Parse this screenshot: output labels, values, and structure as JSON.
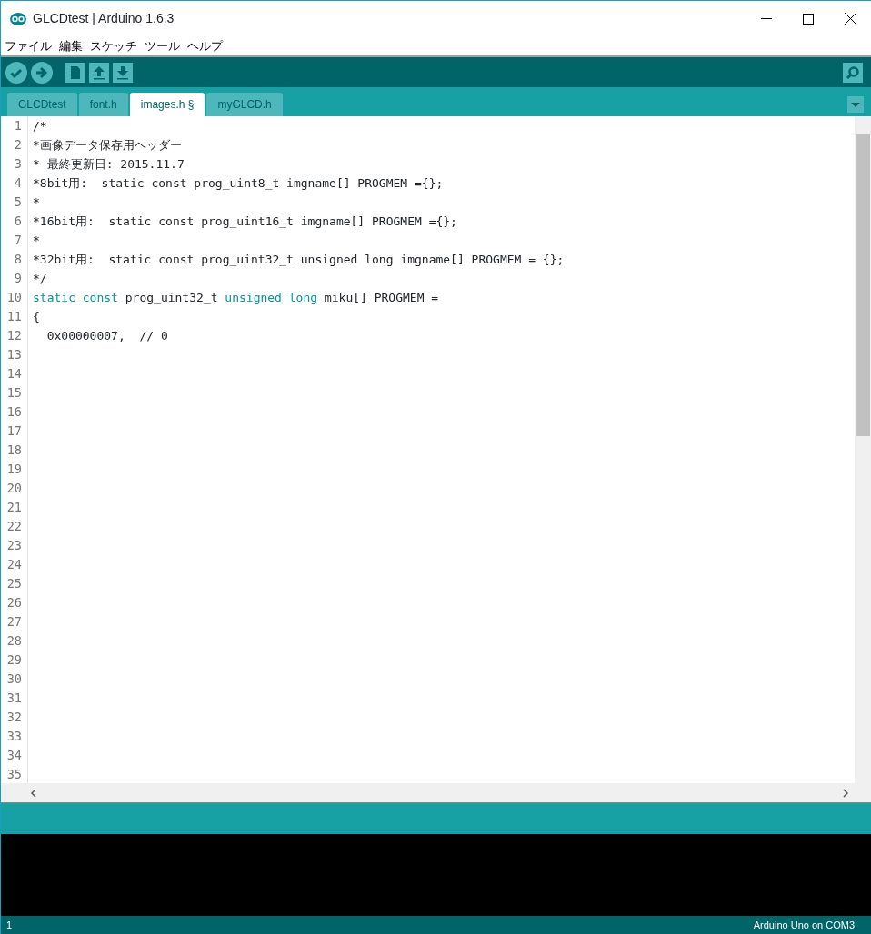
{
  "window": {
    "title": "GLCDtest | Arduino 1.6.3"
  },
  "menu": [
    "ファイル",
    "編集",
    "スケッチ",
    "ツール",
    "ヘルプ"
  ],
  "tabs": [
    {
      "label": "GLCDtest",
      "selected": false
    },
    {
      "label": "font.h",
      "selected": false
    },
    {
      "label": "images.h §",
      "selected": true
    },
    {
      "label": "myGLCD.h",
      "selected": false
    }
  ],
  "editor": {
    "lines": [
      {
        "number": "1",
        "tokens": [
          {
            "kind": "plain",
            "text": "/*"
          }
        ]
      },
      {
        "number": "2",
        "tokens": [
          {
            "kind": "plain",
            "text": "*画像データ保存用ヘッダー"
          }
        ]
      },
      {
        "number": "3",
        "tokens": [
          {
            "kind": "plain",
            "text": "* 最終更新日: 2015.11.7"
          }
        ]
      },
      {
        "number": "4",
        "tokens": [
          {
            "kind": "plain",
            "text": "*8bit用:  static const prog_uint8_t imgname[] PROGMEM ={};"
          }
        ]
      },
      {
        "number": "5",
        "tokens": [
          {
            "kind": "plain",
            "text": "*"
          }
        ]
      },
      {
        "number": "6",
        "tokens": [
          {
            "kind": "plain",
            "text": "*16bit用:  static const prog_uint16_t imgname[] PROGMEM ={};"
          }
        ]
      },
      {
        "number": "7",
        "tokens": [
          {
            "kind": "plain",
            "text": "*"
          }
        ]
      },
      {
        "number": "8",
        "tokens": [
          {
            "kind": "plain",
            "text": "*32bit用:  static const prog_uint32_t unsigned long imgname[] PROGMEM = {};"
          }
        ]
      },
      {
        "number": "9",
        "tokens": [
          {
            "kind": "plain",
            "text": "*/"
          }
        ]
      },
      {
        "number": "10",
        "tokens": [
          {
            "kind": "keyword",
            "text": "static const"
          },
          {
            "kind": "plain",
            "text": " prog_uint32_t "
          },
          {
            "kind": "keyword",
            "text": "unsigned long"
          },
          {
            "kind": "plain",
            "text": " miku[] PROGMEM ="
          }
        ]
      },
      {
        "number": "11",
        "tokens": [
          {
            "kind": "plain",
            "text": "{"
          }
        ]
      },
      {
        "number": "12",
        "tokens": [
          {
            "kind": "plain",
            "text": "  0x00000007,  // 0"
          }
        ]
      },
      {
        "number": "13"
      },
      {
        "number": "14"
      },
      {
        "number": "15"
      },
      {
        "number": "16"
      },
      {
        "number": "17"
      },
      {
        "number": "18"
      },
      {
        "number": "19"
      },
      {
        "number": "20"
      },
      {
        "number": "21"
      },
      {
        "number": "22"
      },
      {
        "number": "23"
      },
      {
        "number": "24"
      },
      {
        "number": "25"
      },
      {
        "number": "26"
      },
      {
        "number": "27"
      },
      {
        "number": "28"
      },
      {
        "number": "29"
      },
      {
        "number": "30"
      },
      {
        "number": "31"
      },
      {
        "number": "32"
      },
      {
        "number": "33"
      },
      {
        "number": "34"
      },
      {
        "number": "35"
      }
    ]
  },
  "status_bar": {
    "line": "1",
    "board": "Arduino Uno on COM3"
  }
}
